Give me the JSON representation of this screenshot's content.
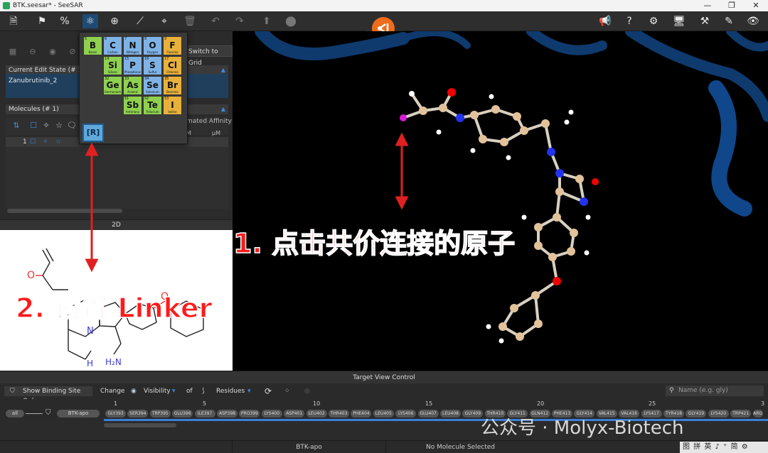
{
  "window": {
    "title": "BTK.seesar* - SeeSAR",
    "minimize": "—",
    "maximize": "❐",
    "close": "✕"
  },
  "left_panel": {
    "switch_to_grid": "Switch to Grid",
    "current_edit_state": {
      "header": "Current Edit State (# 1)",
      "value": "Zanubrutinib_2"
    },
    "molecules": {
      "header": "Molecules (# 1)",
      "est_affinity_header": "mated Affinity",
      "unit_m": "M",
      "unit_um": "μM",
      "rows": [
        {
          "index": "1"
        }
      ]
    },
    "twod_header": "2D",
    "twod_labels": {
      "n": "N",
      "nh": "H",
      "nh2": "H₂N"
    }
  },
  "periodic_table": {
    "elements": [
      {
        "num": "5",
        "sym": "B",
        "name": "Boron",
        "color": "g"
      },
      {
        "num": "6",
        "sym": "C",
        "name": "Carbon",
        "color": "b"
      },
      {
        "num": "7",
        "sym": "N",
        "name": "Nitrogen",
        "color": "b"
      },
      {
        "num": "8",
        "sym": "O",
        "name": "Oxygen",
        "color": "b"
      },
      {
        "num": "9",
        "sym": "F",
        "name": "Fluorine",
        "color": "o"
      },
      {
        "num": "14",
        "sym": "Si",
        "name": "Silicon",
        "color": "g"
      },
      {
        "num": "15",
        "sym": "P",
        "name": "Phosphorus",
        "color": "b"
      },
      {
        "num": "16",
        "sym": "S",
        "name": "Sulfur",
        "color": "b"
      },
      {
        "num": "17",
        "sym": "Cl",
        "name": "Chlorine",
        "color": "o"
      },
      {
        "num": "32",
        "sym": "Ge",
        "name": "Germanium",
        "color": "g"
      },
      {
        "num": "33",
        "sym": "As",
        "name": "Arsenic",
        "color": "g"
      },
      {
        "num": "34",
        "sym": "Se",
        "name": "Selenium",
        "color": "b"
      },
      {
        "num": "35",
        "sym": "Br",
        "name": "Bromine",
        "color": "o"
      },
      {
        "num": "51",
        "sym": "Sb",
        "name": "Antimony",
        "color": "g"
      },
      {
        "num": "52",
        "sym": "Te",
        "name": "Tellurium",
        "color": "g"
      },
      {
        "num": "53",
        "sym": "I",
        "name": "Iodine",
        "color": "o"
      }
    ],
    "r_button": "[R]"
  },
  "bottom_panel": {
    "header": "Target View Control",
    "show_binding_site": "Show Binding Site Only",
    "change_label": "Change",
    "visibility_label": "Visibility",
    "of_label": "of",
    "residues_label": "Residues",
    "search_placeholder": "Name (e.g. gly)",
    "ruler_ticks": [
      "1",
      "5",
      "10",
      "15",
      "20",
      "25",
      "3"
    ],
    "all_label": "all",
    "chain_label": "BTK-apo",
    "residues": [
      "GLY393",
      "SER394",
      "TRP395",
      "GLU396",
      "ILE397",
      "ASP398",
      "PRO399",
      "LYS400",
      "ASP401",
      "LEU402",
      "THR403",
      "PHE404",
      "LEU405",
      "LYS406",
      "GLU407",
      "LEU408",
      "GLY409",
      "THR410",
      "GLY411",
      "GLN412",
      "PHE413",
      "GLY414",
      "VAL415",
      "VAL416",
      "LYS417",
      "TYR418",
      "GLY419",
      "LYS420",
      "TRP421",
      "ARG"
    ]
  },
  "status_bar": {
    "left": "",
    "middle": "BTK-apo",
    "right": "No Molecule Selected"
  },
  "annotations": {
    "step1": "1. 点击共价连接的原子",
    "step2": "2. 设置 Linker"
  },
  "watermark": "公众号 · Molyx-Biotech",
  "ime_bar": "图 拼 英 ♪ ⁺ 简 ⚙"
}
